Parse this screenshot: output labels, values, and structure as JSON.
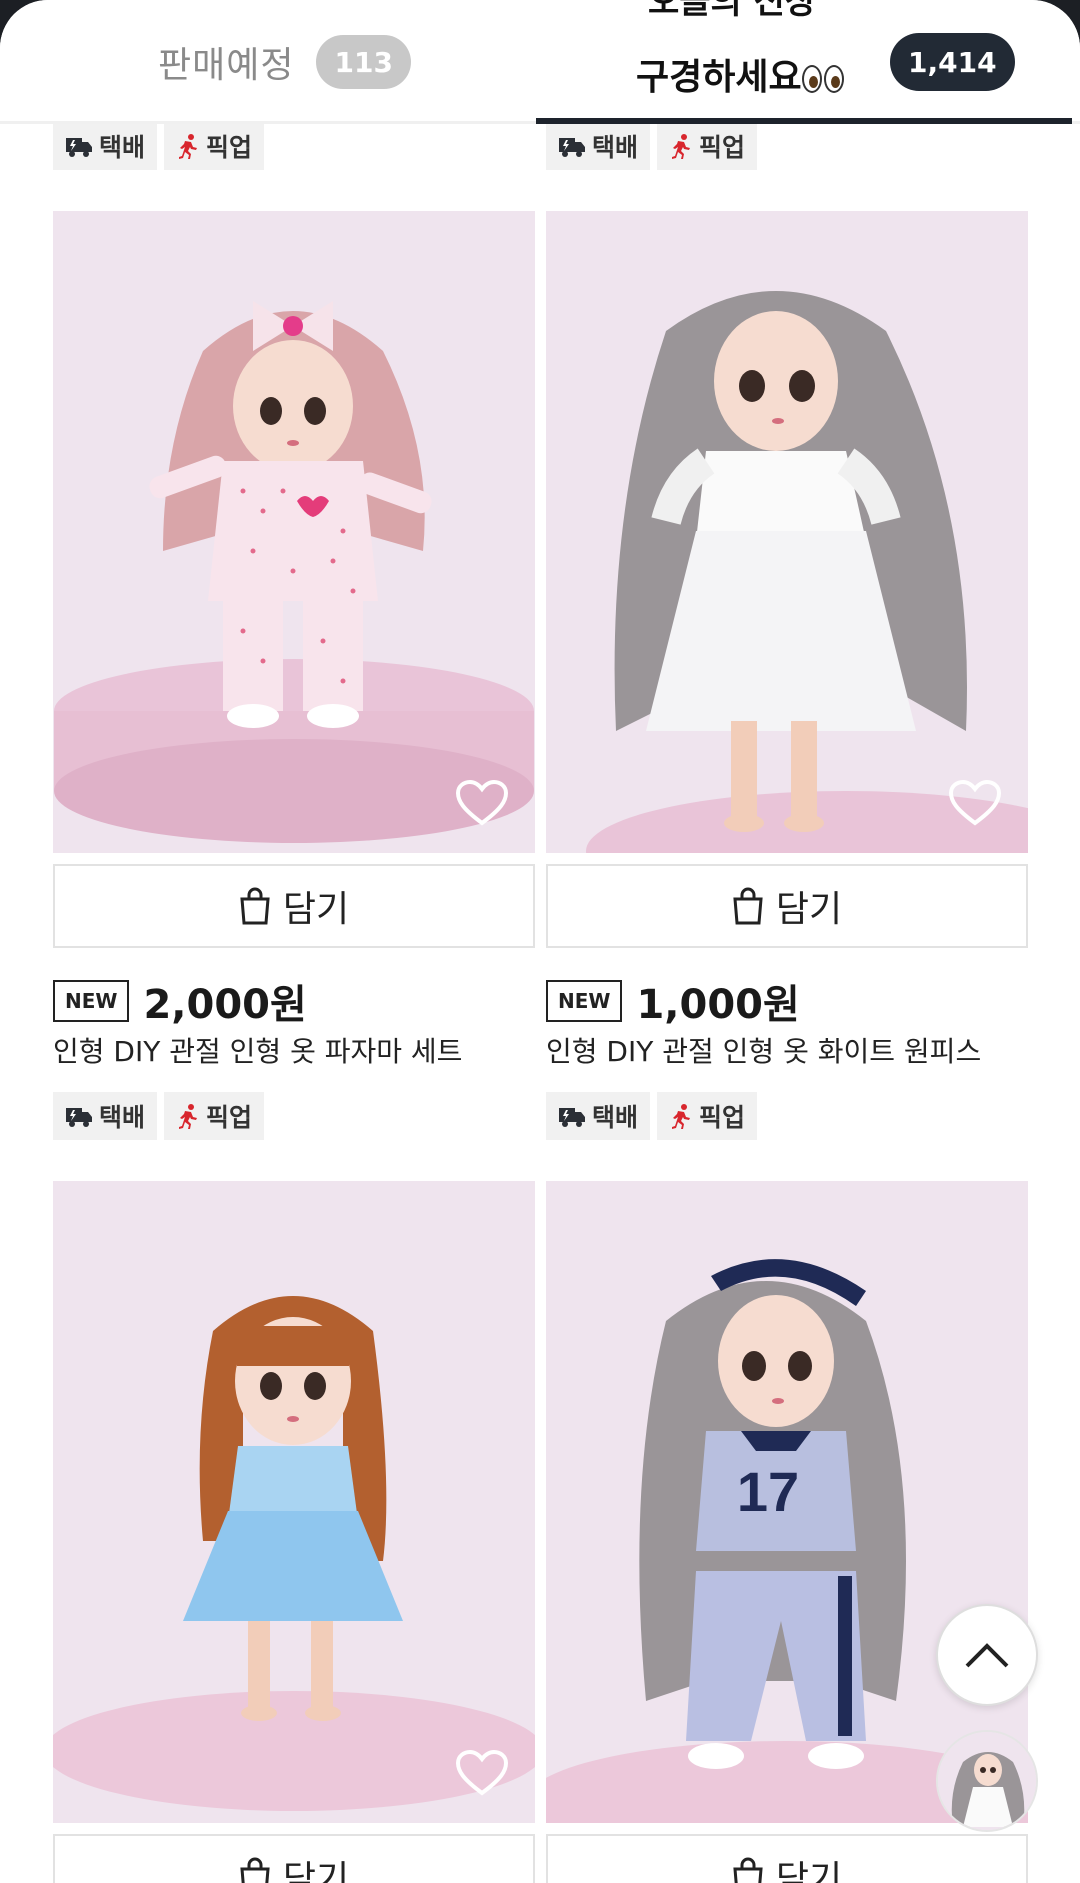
{
  "tabs": {
    "left": {
      "label": "판매예정",
      "count": "113"
    },
    "right": {
      "title_line1": "오늘의 신상",
      "title_line2": "구경하세요",
      "count": "1,414"
    }
  },
  "tags": {
    "delivery": "택배",
    "pickup": "픽업"
  },
  "add_label": "담기",
  "new_badge": "NEW",
  "products": [
    {
      "price": "2,000원",
      "name": "인형 DIY 관절 인형 옷 파자마 세트"
    },
    {
      "price": "1,000원",
      "name": "인형 DIY 관절 인형 옷 화이트 원피스"
    },
    {
      "price": "",
      "name": ""
    },
    {
      "price": "",
      "name": ""
    }
  ],
  "colors": {
    "accent_dark": "#1d232c",
    "pickup_red": "#d8262d",
    "photo_bg": "#efe4ee"
  },
  "icons": [
    "truck-icon",
    "runner-icon",
    "shopping-bag-icon",
    "heart-icon",
    "chevron-up-icon"
  ]
}
